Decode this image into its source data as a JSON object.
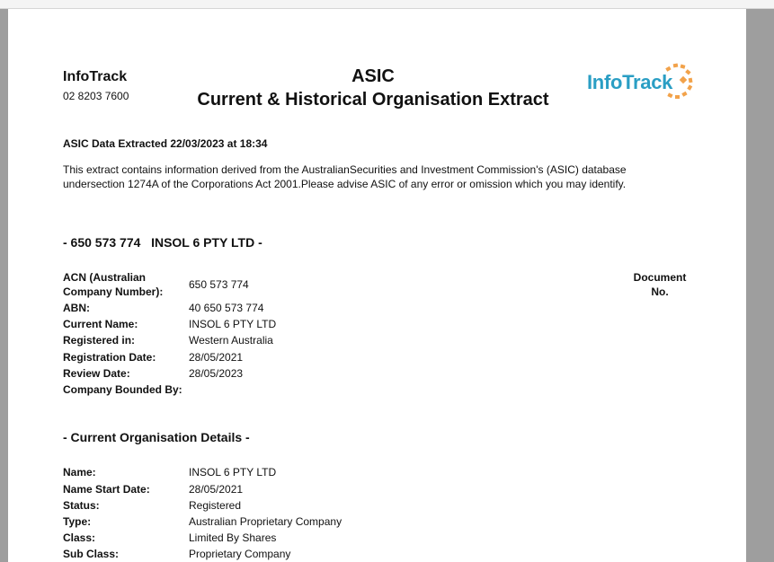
{
  "header": {
    "brand_name": "InfoTrack",
    "phone": "02 8203 7600",
    "title_line1": "ASIC",
    "title_line2": "Current & Historical Organisation Extract",
    "logo_text": "InfoTrack"
  },
  "extracted": "ASIC Data Extracted 22/03/2023 at 18:34",
  "intro": {
    "line1": "This extract contains information derived from the AustralianSecurities and Investment Commission's (ASIC) database",
    "line2": "undersection 1274A of the Corporations Act 2001.Please advise ASIC of any error or omission which you may identify."
  },
  "company_section": {
    "title": "- 650 573 774   INSOL 6 PTY LTD -",
    "document_header_line1": "Document",
    "document_header_line2": "No.",
    "fields": [
      {
        "label_line1": "ACN (Australian",
        "label_line2": "Company Number):",
        "value": "650 573 774"
      },
      {
        "label": "ABN:",
        "value": "40 650 573 774"
      },
      {
        "label": "Current Name:",
        "value": "INSOL 6 PTY LTD"
      },
      {
        "label": "Registered in:",
        "value": "Western Australia"
      },
      {
        "label": "Registration Date:",
        "value": "28/05/2021"
      },
      {
        "label": "Review Date:",
        "value": "28/05/2023"
      },
      {
        "label": "Company Bounded By:",
        "value": ""
      }
    ]
  },
  "org_section": {
    "title": "- Current Organisation Details -",
    "fields": [
      {
        "label": "Name:",
        "value": "INSOL 6 PTY LTD"
      },
      {
        "label": "Name Start Date:",
        "value": "28/05/2021"
      },
      {
        "label": "Status:",
        "value": "Registered"
      },
      {
        "label": "Type:",
        "value": "Australian Proprietary Company"
      },
      {
        "label": "Class:",
        "value": "Limited By Shares"
      },
      {
        "label": "Sub Class:",
        "value": "Proprietary Company"
      }
    ]
  },
  "colors": {
    "logo_blue": "#2a9ec4",
    "logo_orange": "#f2a24a",
    "viewer_background": "#9e9e9e"
  }
}
